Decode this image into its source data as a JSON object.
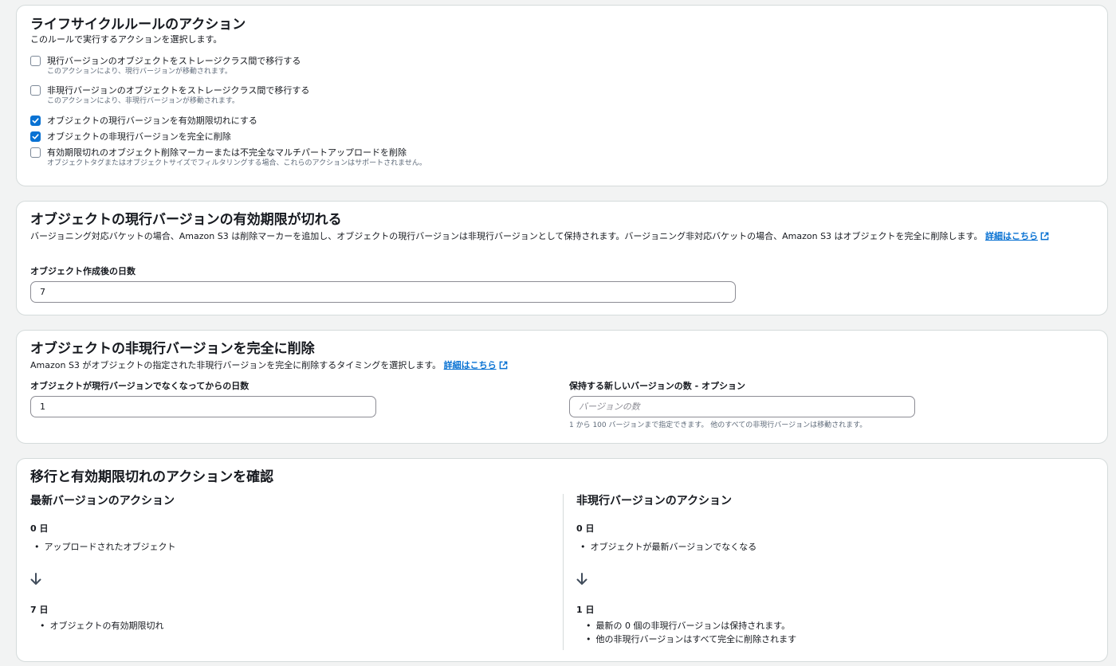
{
  "actions_panel": {
    "title": "ライフサイクルルールのアクション",
    "description": "このルールで実行するアクションを選択します。",
    "options": [
      {
        "label": "現行バージョンのオブジェクトをストレージクラス間で移行する",
        "hint": "このアクションにより、現行バージョンが移動されます。",
        "checked": false
      },
      {
        "label": "非現行バージョンのオブジェクトをストレージクラス間で移行する",
        "hint": "このアクションにより、非現行バージョンが移動されます。",
        "checked": false
      },
      {
        "label": "オブジェクトの現行バージョンを有効期限切れにする",
        "hint": "",
        "checked": true
      },
      {
        "label": "オブジェクトの非現行バージョンを完全に削除",
        "hint": "",
        "checked": true
      },
      {
        "label": "有効期限切れのオブジェクト削除マーカーまたは不完全なマルチパートアップロードを削除",
        "hint": "オブジェクトタグまたはオブジェクトサイズでフィルタリングする場合、これらのアクションはサポートされません。",
        "checked": false
      }
    ]
  },
  "expire_panel": {
    "title": "オブジェクトの現行バージョンの有効期限が切れる",
    "description": "バージョニング対応バケットの場合、Amazon S3 は削除マーカーを追加し、オブジェクトの現行バージョンは非現行バージョンとして保持されます。バージョニング非対応バケットの場合、Amazon S3 はオブジェクトを完全に削除します。",
    "link_part1": "詳細はこち",
    "link_part2": "ら",
    "field_label": "オブジェクト作成後の日数",
    "field_value": "7"
  },
  "delete_panel": {
    "title": "オブジェクトの非現行バージョンを完全に削除",
    "description": "Amazon S3 がオブジェクトの指定された非現行バージョンを完全に削除するタイミングを選択します。",
    "link": "詳細はこちら",
    "days_label": "オブジェクトが現行バージョンでなくなってからの日数",
    "days_value": "1",
    "versions_label": "保持する新しいバージョンの数 - オプション",
    "versions_placeholder": "バージョンの数",
    "versions_hint": "1 から 100 バージョンまで指定できます。 他のすべての非現行バージョンは移動されます。"
  },
  "review_panel": {
    "title": "移行と有効期限切れのアクションを確認",
    "current": {
      "title": "最新バージョンのアクション",
      "step1_day": "0 日",
      "step1_items": [
        "アップロードされたオブジェクト"
      ],
      "step2_day": "7 日",
      "step2_items": [
        "オブジェクトの有効期限切れ"
      ]
    },
    "noncurrent": {
      "title": "非現行バージョンのアクション",
      "step1_day": "0 日",
      "step1_items": [
        "オブジェクトが最新バージョンでなくなる"
      ],
      "step2_day": "1 日",
      "step2_items": [
        "最新の 0 個の非現行バージョンは保持されます。",
        "他の非現行バージョンはすべて完全に削除されます"
      ]
    }
  },
  "colors": {
    "link": "#0972d3",
    "checkbox_checked": "#0972d3",
    "border": "#d5dbdb"
  }
}
